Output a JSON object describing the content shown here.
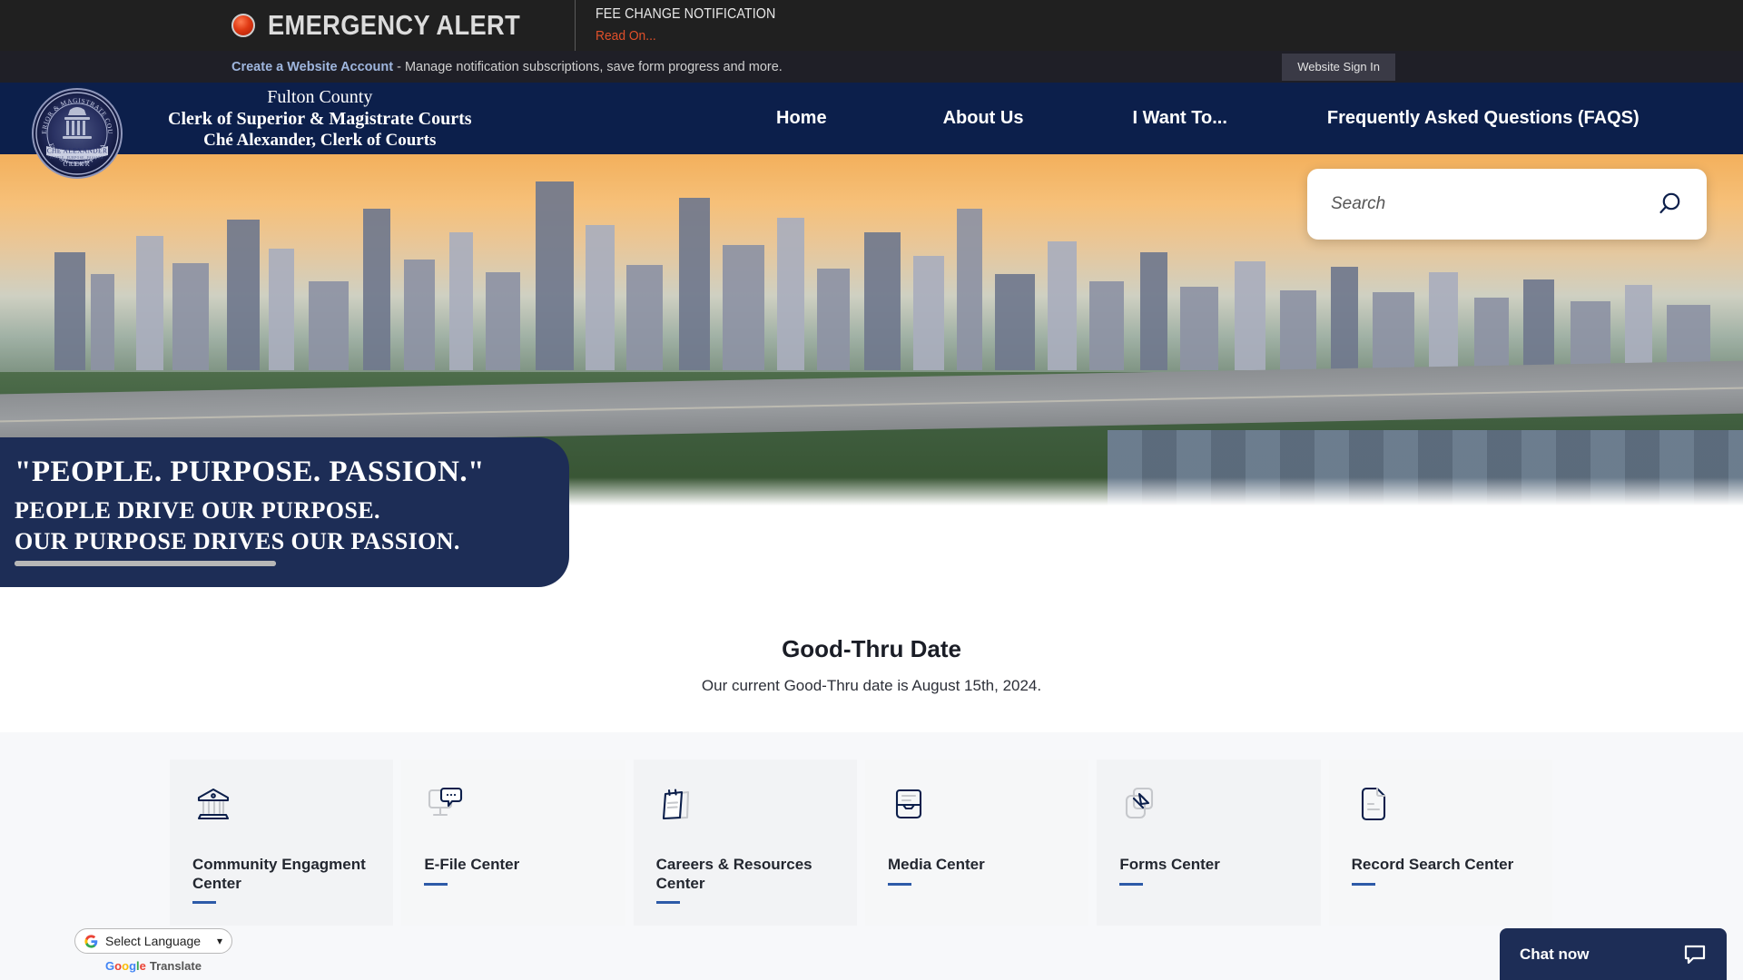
{
  "alert": {
    "icon": "alert-light-icon",
    "title": "EMERGENCY ALERT",
    "message_title": "FEE CHANGE NOTIFICATION",
    "message_link": "Read On..."
  },
  "account_bar": {
    "link": "Create a Website Account",
    "text": " - Manage notification subscriptions, save form progress and more.",
    "signin_button": "Website Sign In"
  },
  "header": {
    "brand_line1": "Fulton County",
    "brand_line2": "Clerk of Superior & Magistrate Courts",
    "brand_line3": "Ché Alexander, Clerk of Courts",
    "seal": {
      "outer_top": "SUPERIOR & MAGISTRATE COURTS",
      "outer_bottom": "FULTON COUNTY, GA",
      "name": "CHÉ ALEXANDER",
      "role": "CLERK",
      "motto": "PEOPLE. PURPOSE. PASSION."
    },
    "nav": [
      {
        "label": "Home"
      },
      {
        "label": "About Us"
      },
      {
        "label": "I Want To..."
      },
      {
        "label": "Frequently Asked Questions (FAQS)"
      }
    ]
  },
  "search": {
    "placeholder": "Search",
    "icon": "search-icon"
  },
  "hero": {
    "caption_line1": "\"PEOPLE. PURPOSE. PASSION.\"",
    "caption_line2": "PEOPLE DRIVE OUR PURPOSE.",
    "caption_line3": "OUR PURPOSE DRIVES OUR PASSION."
  },
  "goodthru": {
    "title": "Good-Thru Date",
    "subtitle": "Our current Good-Thru date is August 15th, 2024."
  },
  "cards": [
    {
      "label": "Community Engagment Center",
      "icon": "bank-building-icon"
    },
    {
      "label": "E-File Center",
      "icon": "chat-monitor-icon"
    },
    {
      "label": "Careers & Resources Center",
      "icon": "notepad-icon"
    },
    {
      "label": "Media Center",
      "icon": "inbox-icon"
    },
    {
      "label": "Forms Center",
      "icon": "copy-pages-icon"
    },
    {
      "label": "Record Search Center",
      "icon": "document-icon"
    }
  ],
  "translate": {
    "selected": "Select Language",
    "footer_google": "Google",
    "footer_translate": "Translate",
    "g_letters": [
      "G",
      "o",
      "o",
      "g",
      "l",
      "e"
    ]
  },
  "chat": {
    "label": "Chat now",
    "icon": "chat-bubble-icon"
  },
  "colors": {
    "navy": "#0c1f4b",
    "caption_navy": "#1d2d56",
    "alert_bg": "#202020",
    "alert_red": "#e0502a",
    "accent_blue": "#2d5aa8"
  }
}
